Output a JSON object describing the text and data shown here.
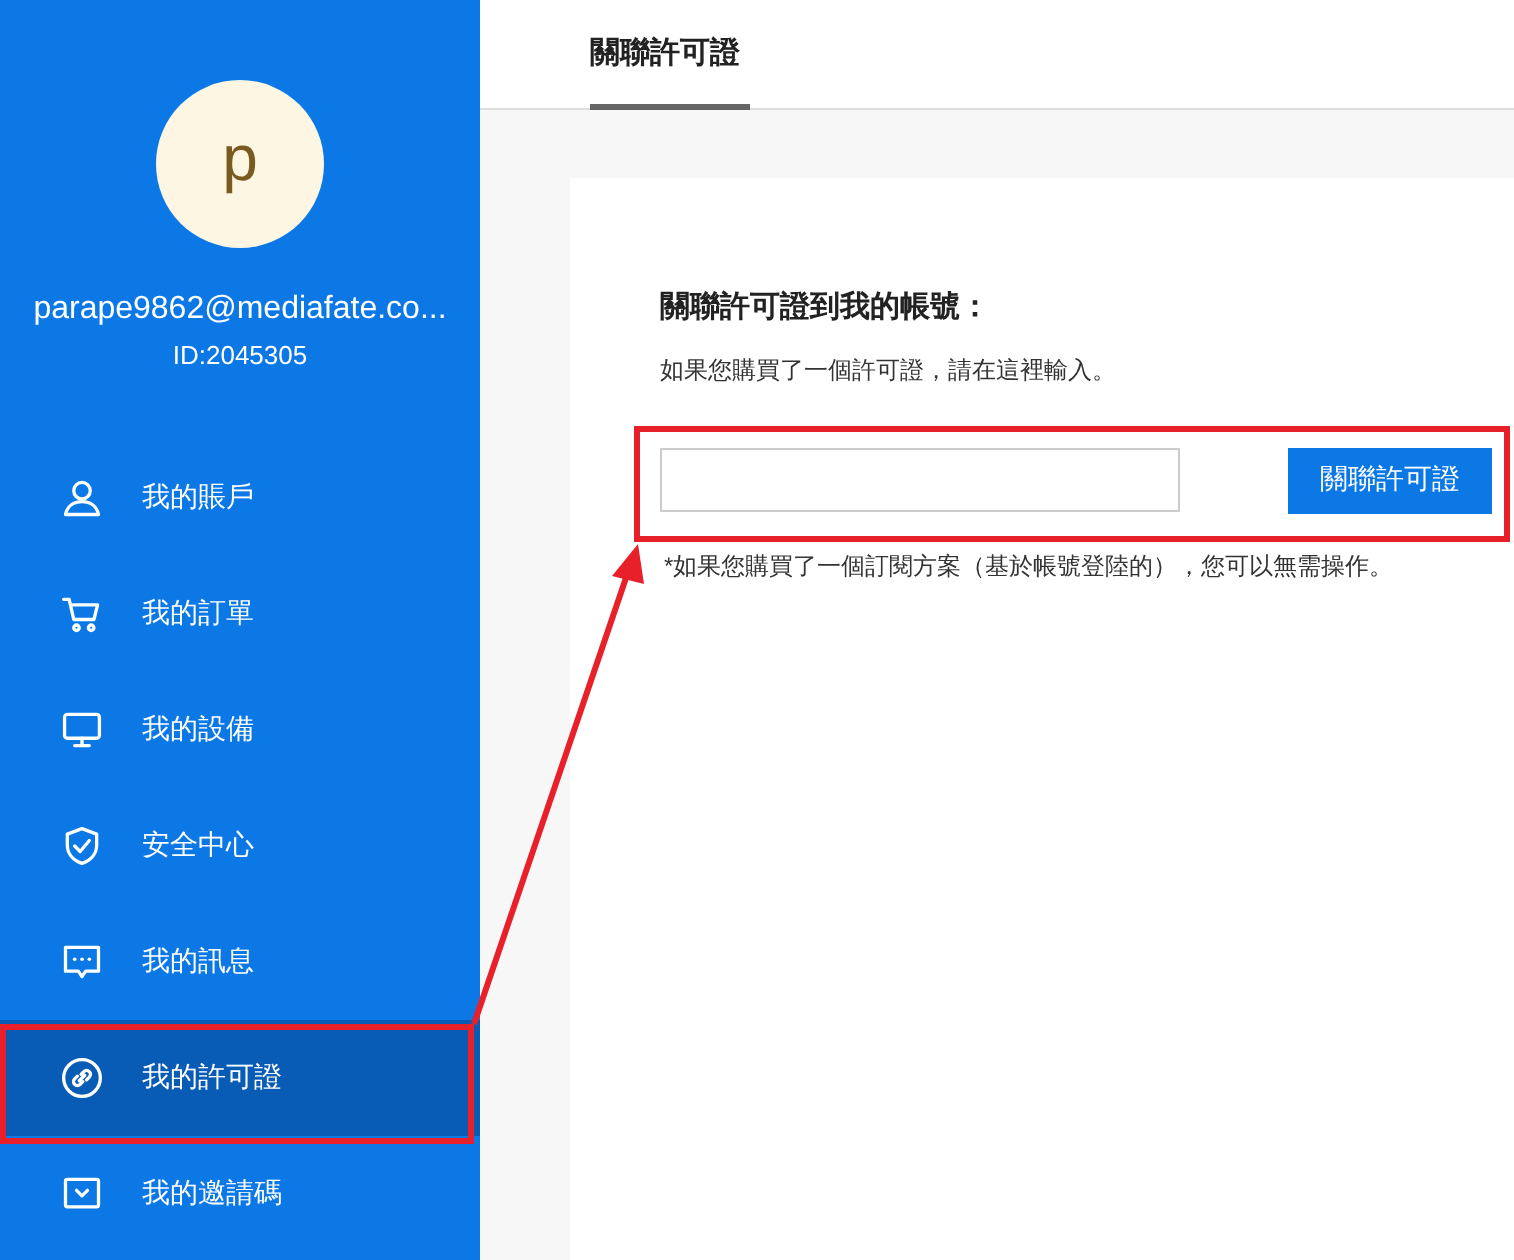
{
  "sidebar": {
    "avatar": {
      "initial": "p"
    },
    "email": "parape9862@mediafate.co...",
    "user_id": "ID:2045305",
    "items": [
      {
        "label": "我的賬戶",
        "selected": false
      },
      {
        "label": "我的訂單",
        "selected": false
      },
      {
        "label": "我的設備",
        "selected": false
      },
      {
        "label": "安全中心",
        "selected": false
      },
      {
        "label": "我的訊息",
        "selected": false
      },
      {
        "label": "我的許可證",
        "selected": true
      },
      {
        "label": "我的邀請碼",
        "selected": false
      }
    ]
  },
  "main": {
    "tabs": [
      {
        "label": "關聯許可證",
        "selected": true
      }
    ],
    "card": {
      "heading": "關聯許可證到我的帳號：",
      "hint": "如果您購買了一個許可證，請在這裡輸入。",
      "button": "關聯許可證",
      "note": "*如果您購買了一個訂閱方案（基於帳號登陸的），您可以無需操作。"
    }
  }
}
